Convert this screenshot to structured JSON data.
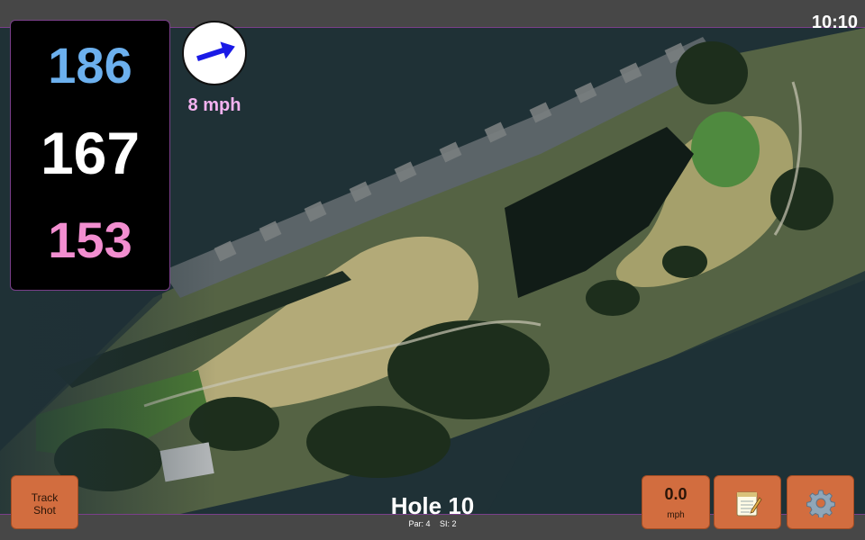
{
  "status": {
    "time": "10:10"
  },
  "yardages": {
    "back": {
      "value": "186",
      "color": "#6cb0ee"
    },
    "middle": {
      "value": "167",
      "color": "#ffffff"
    },
    "front": {
      "value": "153",
      "color": "#f28ed0"
    }
  },
  "wind": {
    "speed": "8 mph",
    "speed_color": "#f4b2f0",
    "arrow_color": "#1a1ae6",
    "direction_icon": "arrow-icon"
  },
  "controls": {
    "track_shot": {
      "line1": "Track",
      "line2": "Shot"
    },
    "speed": {
      "value": "0.0",
      "unit": "mph"
    },
    "notes": {
      "icon": "notepad-icon"
    },
    "settings": {
      "icon": "gear-icon"
    },
    "button_color": "#d26d3f"
  },
  "hole": {
    "title": "Hole 10",
    "par": "Par: 4",
    "si": "SI: 2"
  }
}
